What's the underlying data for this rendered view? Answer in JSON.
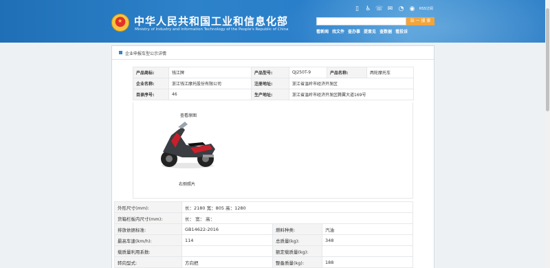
{
  "header": {
    "title_cn": "中华人民共和国工业和信息化部",
    "title_en": "Ministry of Industry and Information Technology of the People's Republic of China",
    "rss_label": "RSS订阅",
    "search_button": "站 一 搜 索",
    "nav": [
      "看新闻",
      "找文件",
      "查办事",
      "提意见",
      "查数据",
      "看投诉"
    ]
  },
  "panel": {
    "title": "企业申报车型公示详情"
  },
  "info": {
    "rows": [
      [
        "产品商标:",
        "钱江牌",
        "产品型号:",
        "QJ250T-9",
        "产品名称:",
        "两轮摩托车"
      ],
      [
        "企业名称:",
        "浙江钱江摩托股份有限公司",
        "注册地址:",
        "浙江省温岭市经济开发区"
      ],
      [
        "目录序号:",
        "46",
        "生产地址:",
        "浙江省温岭市经济开发区腾翼大道169号"
      ]
    ]
  },
  "photo": {
    "view_back": "查看原图",
    "caption": "右侧照片"
  },
  "spec": {
    "rows": [
      [
        "外形尺寸(mm):",
        "长：2180 宽：805 高：1280"
      ],
      [
        "货箱栏板内尺寸(mm):",
        "长：  宽：  高："
      ],
      [
        "排放依据标准:",
        "GB14622-2016",
        "燃料种类:",
        "汽油"
      ],
      [
        "最高车速(km/h):",
        "114",
        "总质量(kg):",
        "348"
      ],
      [
        "载质量利用系数:",
        "",
        "额定载质量(kg):",
        ""
      ],
      [
        "转向型式:",
        "方向把",
        "整备质量(kg):",
        "188"
      ]
    ]
  },
  "colors": {
    "header_blue": "#2a7fca",
    "search_button": "#f3a53a"
  }
}
